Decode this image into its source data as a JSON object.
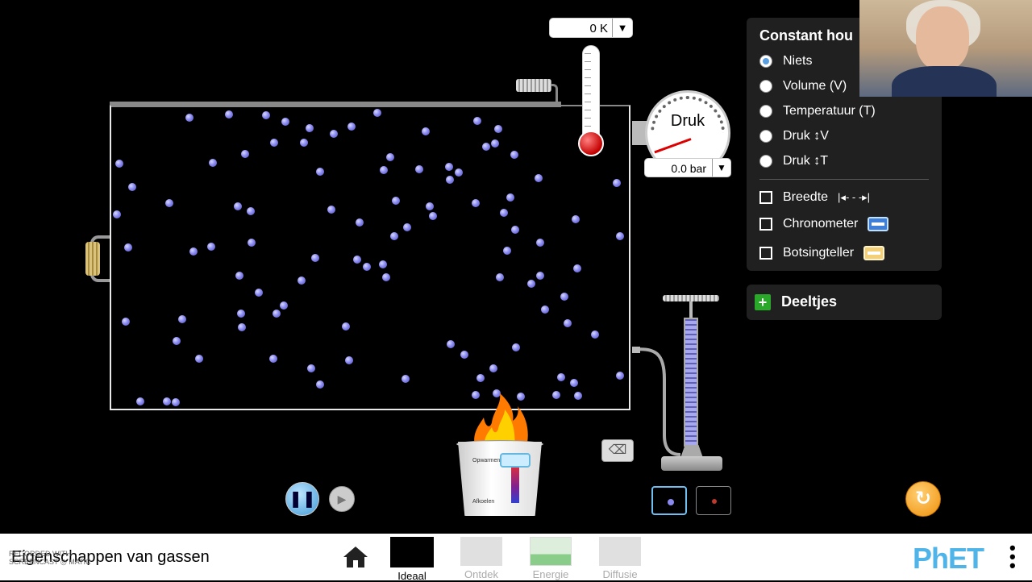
{
  "thermometer": {
    "value": "0 K",
    "dropdown_icon": "▼"
  },
  "pressure_gauge": {
    "label": "Druk",
    "value": "0.0 bar",
    "dropdown_icon": "▼"
  },
  "heater": {
    "heat_label": "Opwarmen",
    "cool_label": "Afkoelen"
  },
  "control_panel": {
    "title": "Constant hou",
    "radios": [
      {
        "label": "Niets",
        "selected": true
      },
      {
        "label": "Volume (V)",
        "selected": false
      },
      {
        "label": "Temperatuur (T)",
        "selected": false
      },
      {
        "label": "Druk ↕V",
        "selected": false
      },
      {
        "label": "Druk ↕T",
        "selected": false
      }
    ],
    "checkboxes": [
      {
        "label": "Breedte",
        "icon": "width-arrow-icon",
        "checked": false
      },
      {
        "label": "Chronometer",
        "icon": "stopwatch-icon",
        "checked": false
      },
      {
        "label": "Botsingteller",
        "icon": "collision-counter-icon",
        "checked": false
      }
    ]
  },
  "particles_panel": {
    "label": "Deeltjes",
    "icon": "+"
  },
  "species": {
    "heavy_color": "#8a8af0",
    "light_color": "#c0392b"
  },
  "sim_controls": {
    "play_pause_icon": "❚❚",
    "step_icon": "▶",
    "reset_icon": "↻"
  },
  "navbar": {
    "title": "Eigenschappen van gassen",
    "watermark": "RECORDED WITH\nSCREENCAST ◎ MATIC",
    "screens": [
      {
        "label": "Ideaal",
        "active": true
      },
      {
        "label": "Ontdek",
        "active": false
      },
      {
        "label": "Energie",
        "active": false
      },
      {
        "label": "Diffusie",
        "active": false
      }
    ],
    "logo": "PhET",
    "menu_icon": "⋮"
  },
  "colors": {
    "accent": "#5a9fe0",
    "particle": "#8a8af0",
    "reset": "#f0900a",
    "add": "#29a829"
  }
}
